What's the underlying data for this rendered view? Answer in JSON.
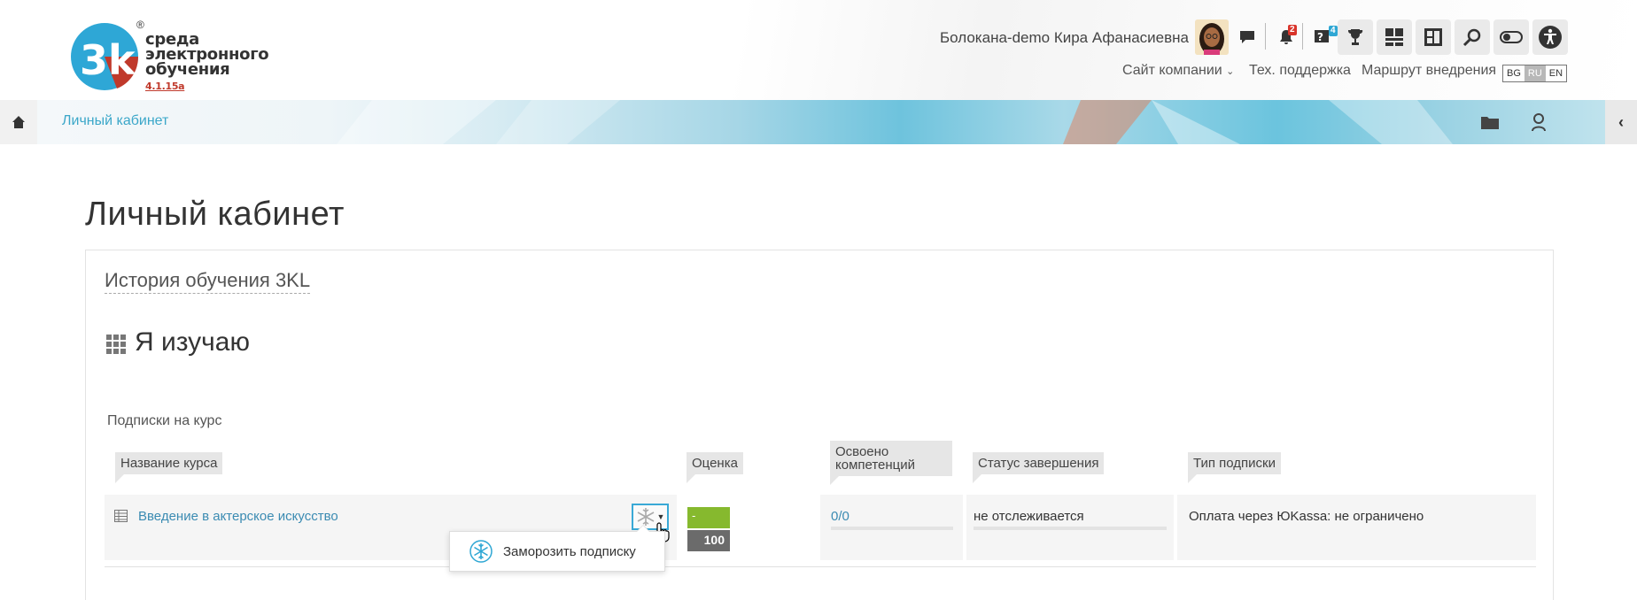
{
  "header": {
    "logo": {
      "line1": "среда",
      "line2": "электронного",
      "line3": "обучения",
      "version": "4.1.15a",
      "mark": "3k",
      "registered": "®"
    },
    "user_name": "Болокана-demo Кира Афанасиевна",
    "badges": {
      "notifications": "2",
      "questions": "4"
    },
    "icons": [
      "chat-icon",
      "bell-icon",
      "question-icon",
      "trophy-icon",
      "dashboard-icon",
      "layout-icon",
      "search-icon",
      "toggle-icon",
      "accessibility-icon"
    ],
    "links": {
      "company_site": "Сайт компании",
      "support": "Тех. поддержка",
      "route": "Маршрут внедрения"
    },
    "languages": [
      {
        "code": "BG",
        "active": false
      },
      {
        "code": "RU",
        "active": true
      },
      {
        "code": "EN",
        "active": false
      }
    ]
  },
  "breadcrumb": {
    "current": "Личный кабинет"
  },
  "main": {
    "page_title": "Личный кабинет",
    "panel_title": "История обучения 3KL",
    "section_title": "Я изучаю",
    "subscriptions_label": "Подписки на курс",
    "table": {
      "headers": {
        "course": "Название курса",
        "grade": "Оценка",
        "competencies": "Освоено компетенций",
        "status": "Статус завершения",
        "subscription_type": "Тип подписки"
      },
      "rows": [
        {
          "course": "Введение в актерское искусство",
          "grade": "-",
          "grade_max": "100",
          "competencies": "0/0",
          "status": "не отслеживается",
          "subscription_type": "Оплата через ЮKassa: не ограничено"
        }
      ]
    },
    "popup": {
      "label": "Заморозить подписку"
    }
  },
  "colors": {
    "accent": "#3aa9d6",
    "link": "#3b8bb2",
    "grade_green": "#86b92e",
    "grade_grey": "#6b6b6b",
    "badge_red": "#d9342b",
    "badge_blue": "#2fa7d4"
  }
}
